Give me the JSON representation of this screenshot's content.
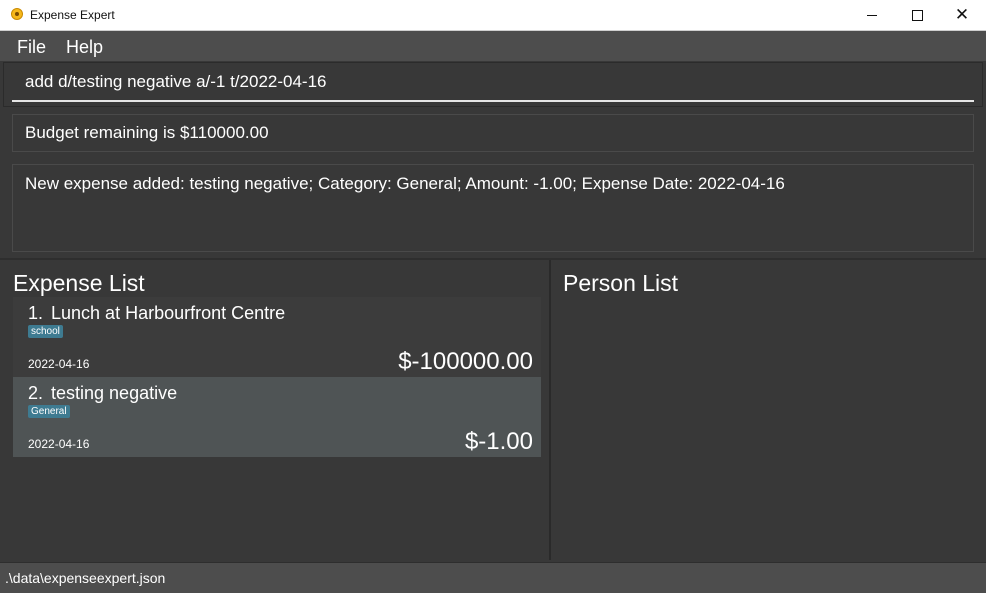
{
  "window": {
    "title": "Expense Expert",
    "app_icon": "app-logo-icon"
  },
  "menu": {
    "file": "File",
    "help": "Help"
  },
  "command": {
    "value": "add d/testing negative a/-1 t/2022-04-16"
  },
  "budget": {
    "text": "Budget remaining is $110000.00"
  },
  "result": {
    "text": "New expense added: testing negative; Category: General; Amount: -1.00; Expense Date: 2022-04-16"
  },
  "expense_list": {
    "title": "Expense List",
    "items": [
      {
        "index": "1.",
        "description": "Lunch at Harbourfront Centre",
        "category": "school",
        "date": "2022-04-16",
        "amount": "$-100000.00"
      },
      {
        "index": "2.",
        "description": "testing negative",
        "category": "General",
        "date": "2022-04-16",
        "amount": "$-1.00"
      }
    ]
  },
  "person_list": {
    "title": "Person List"
  },
  "status": {
    "path": ".\\data\\expenseexpert.json"
  },
  "colors": {
    "background": "#383838",
    "menubar": "#4d4d4d",
    "selected_card": "#4f5455",
    "tag": "#3e7b91"
  }
}
